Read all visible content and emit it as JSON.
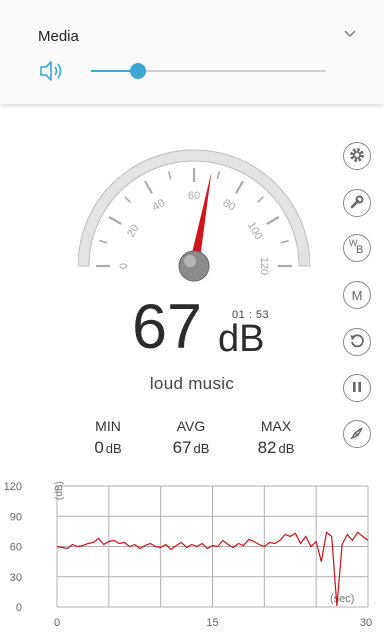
{
  "media": {
    "label": "Media",
    "volume_level": 0.2
  },
  "gauge": {
    "min": 0,
    "max": 120,
    "tick_labels": [
      "0",
      "20",
      "40",
      "60",
      "80",
      "100",
      "120"
    ],
    "needle_value": 67
  },
  "reading": {
    "value": "67",
    "unit": "dB",
    "timer": "01 : 53",
    "label": "loud music"
  },
  "stats": {
    "min": {
      "title": "MIN",
      "value": "0",
      "unit": "dB"
    },
    "avg": {
      "title": "AVG",
      "value": "67",
      "unit": "dB"
    },
    "max": {
      "title": "MAX",
      "value": "82",
      "unit": "dB"
    }
  },
  "side_buttons": [
    {
      "name": "settings-button",
      "icon": "gear-icon"
    },
    {
      "name": "calibrate-button",
      "icon": "wrench-icon"
    },
    {
      "name": "weighting-button",
      "icon": "wb-icon",
      "text": "W",
      "sub": "B"
    },
    {
      "name": "m-button",
      "icon": "m-icon",
      "text": "M"
    },
    {
      "name": "reset-button",
      "icon": "reset-icon"
    },
    {
      "name": "pause-button",
      "icon": "pause-icon"
    },
    {
      "name": "compass-button",
      "icon": "compass-icon"
    }
  ],
  "colors": {
    "accent": "#3aa7d4",
    "needle": "#d4141c",
    "line": "#c8101a"
  },
  "chart_data": {
    "type": "line",
    "x_ticks": [
      "0",
      "15",
      "30"
    ],
    "y_ticks": [
      "0",
      "30",
      "60",
      "90",
      "120"
    ],
    "xlabel": "(sec)",
    "ylabel": "(dB)",
    "xlim": [
      0,
      30
    ],
    "ylim": [
      0,
      120
    ],
    "grid": true,
    "series": [
      {
        "x": [
          0,
          0.5,
          1,
          1.5,
          2,
          2.5,
          3,
          3.5,
          4,
          4.5,
          5,
          5.5,
          6,
          6.5,
          7,
          7.5,
          8,
          8.5,
          9,
          9.5,
          10,
          10.5,
          11,
          11.5,
          12,
          12.5,
          13,
          13.5,
          14,
          14.5,
          15,
          15.5,
          16,
          16.5,
          17,
          17.5,
          18,
          18.5,
          19,
          19.5,
          20,
          20.5,
          21,
          21.5,
          22,
          22.5,
          23,
          23.5,
          24,
          24.5,
          25,
          25.5,
          26,
          26.5,
          27,
          27.5,
          28,
          28.5,
          29,
          29.5,
          30
        ],
        "y": [
          60,
          59,
          58,
          62,
          60,
          61,
          63,
          64,
          68,
          62,
          65,
          66,
          63,
          64,
          60,
          62,
          58,
          61,
          63,
          60,
          59,
          62,
          57,
          61,
          64,
          59,
          62,
          60,
          63,
          58,
          61,
          60,
          66,
          62,
          59,
          63,
          61,
          67,
          65,
          62,
          60,
          64,
          63,
          66,
          72,
          70,
          73,
          63,
          70,
          60,
          65,
          45,
          74,
          70,
          1,
          62,
          72,
          66,
          74,
          70,
          66
        ]
      }
    ]
  }
}
